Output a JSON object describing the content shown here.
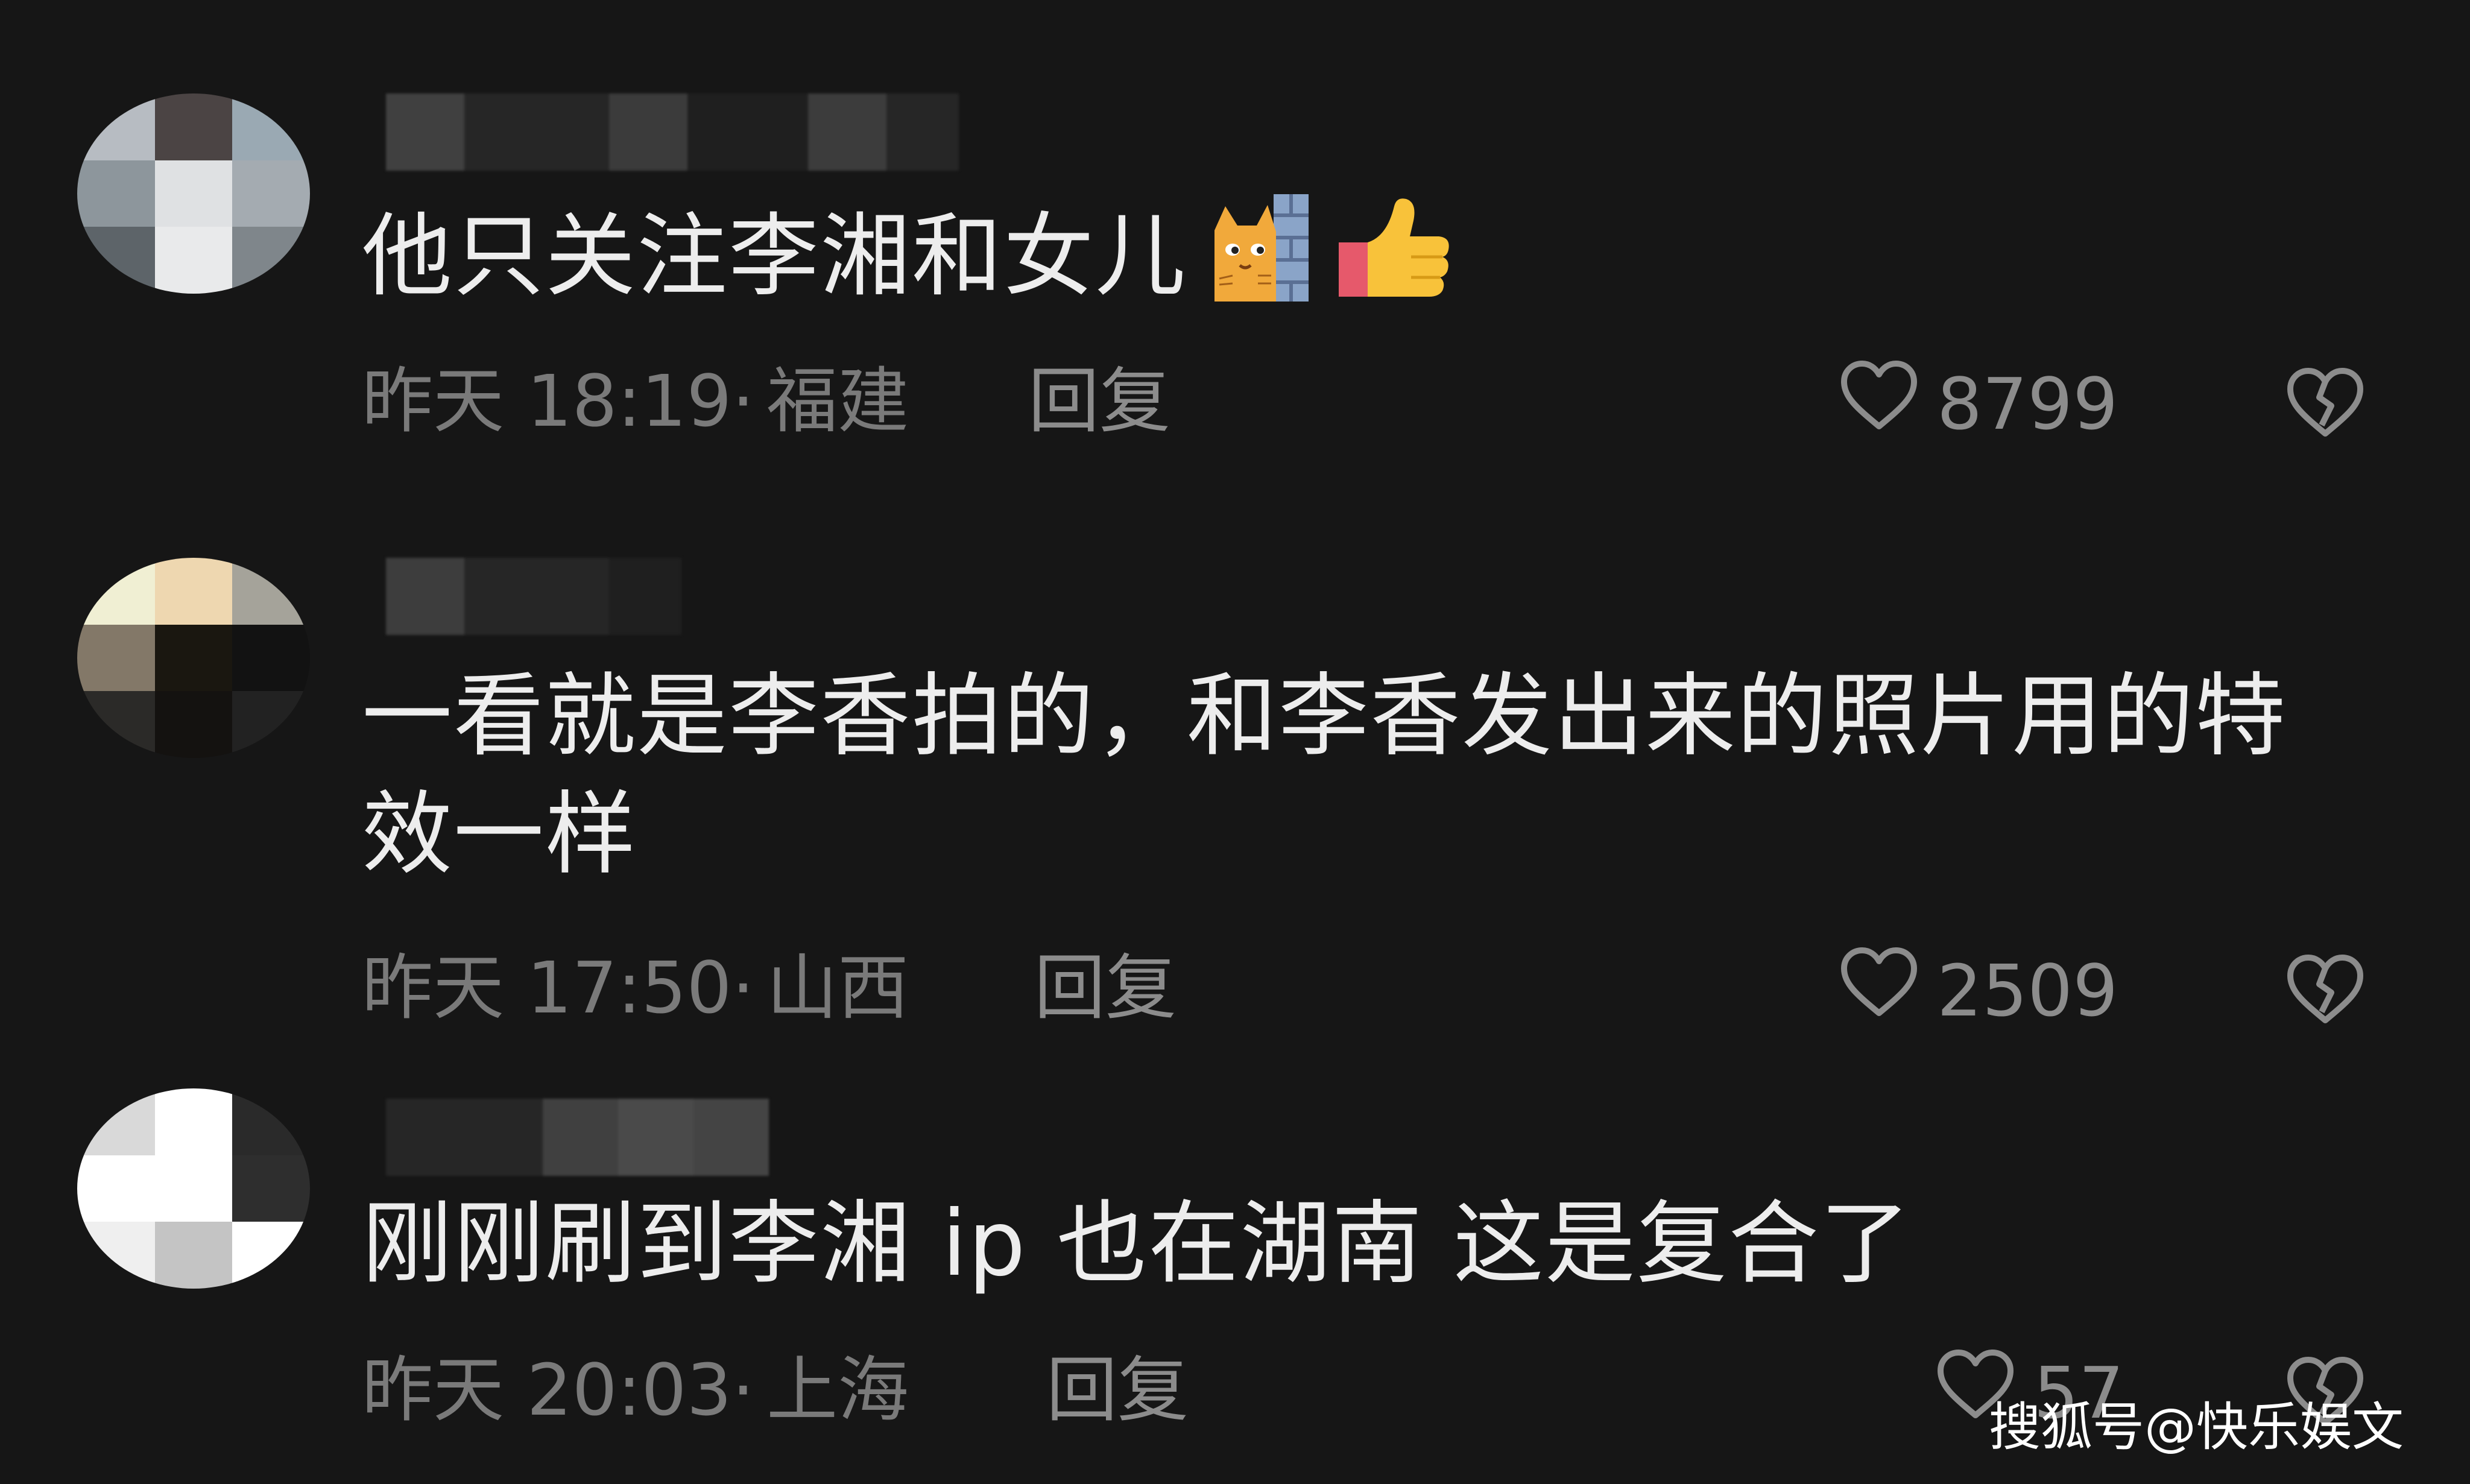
{
  "comments": [
    {
      "text": "他只关注李湘和女儿",
      "emoji": [
        "cat-peeking-wall",
        "thumbs-up"
      ],
      "time": "昨天 18:19",
      "location": "福建",
      "reply_label": "回复",
      "likes": "8799"
    },
    {
      "text": "一看就是李香拍的，和李香发出来的照片用的特效一样",
      "emoji": [],
      "time": "昨天 17:50",
      "location": "山西",
      "reply_label": "回复",
      "likes": "2509"
    },
    {
      "text": "刚刚刷到李湘 ip 也在湖南  这是复合了",
      "emoji": [],
      "time": "昨天 20:03",
      "location": "上海",
      "reply_label": "回复",
      "likes": "57"
    }
  ],
  "separator": "·",
  "watermark": "搜狐号@快乐娱文",
  "colors": {
    "background": "#161616",
    "text": "#ededed",
    "meta": "#7a7a7a"
  },
  "icons": [
    "heart-outline-icon",
    "broken-heart-icon"
  ]
}
